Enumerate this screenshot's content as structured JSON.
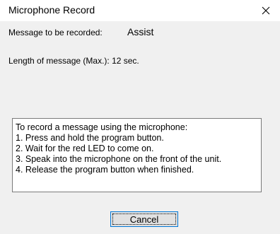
{
  "window": {
    "title": "Microphone Record"
  },
  "message": {
    "label": "Message to be recorded:",
    "value": "Assist"
  },
  "length": {
    "label": "Length of message (Max.): 12 sec."
  },
  "instructions": {
    "lines": [
      "To record a message using the microphone:",
      "1. Press and hold the program button.",
      "2. Wait for the red LED to come on.",
      "3. Speak into the microphone on the front of the unit.",
      "4. Release the program button when finished."
    ]
  },
  "buttons": {
    "cancel_label": "Cancel"
  },
  "icons": {
    "close": "close-icon"
  },
  "colors": {
    "focus_border": "#0078d7",
    "dialog_background": "#f0f0f0"
  }
}
